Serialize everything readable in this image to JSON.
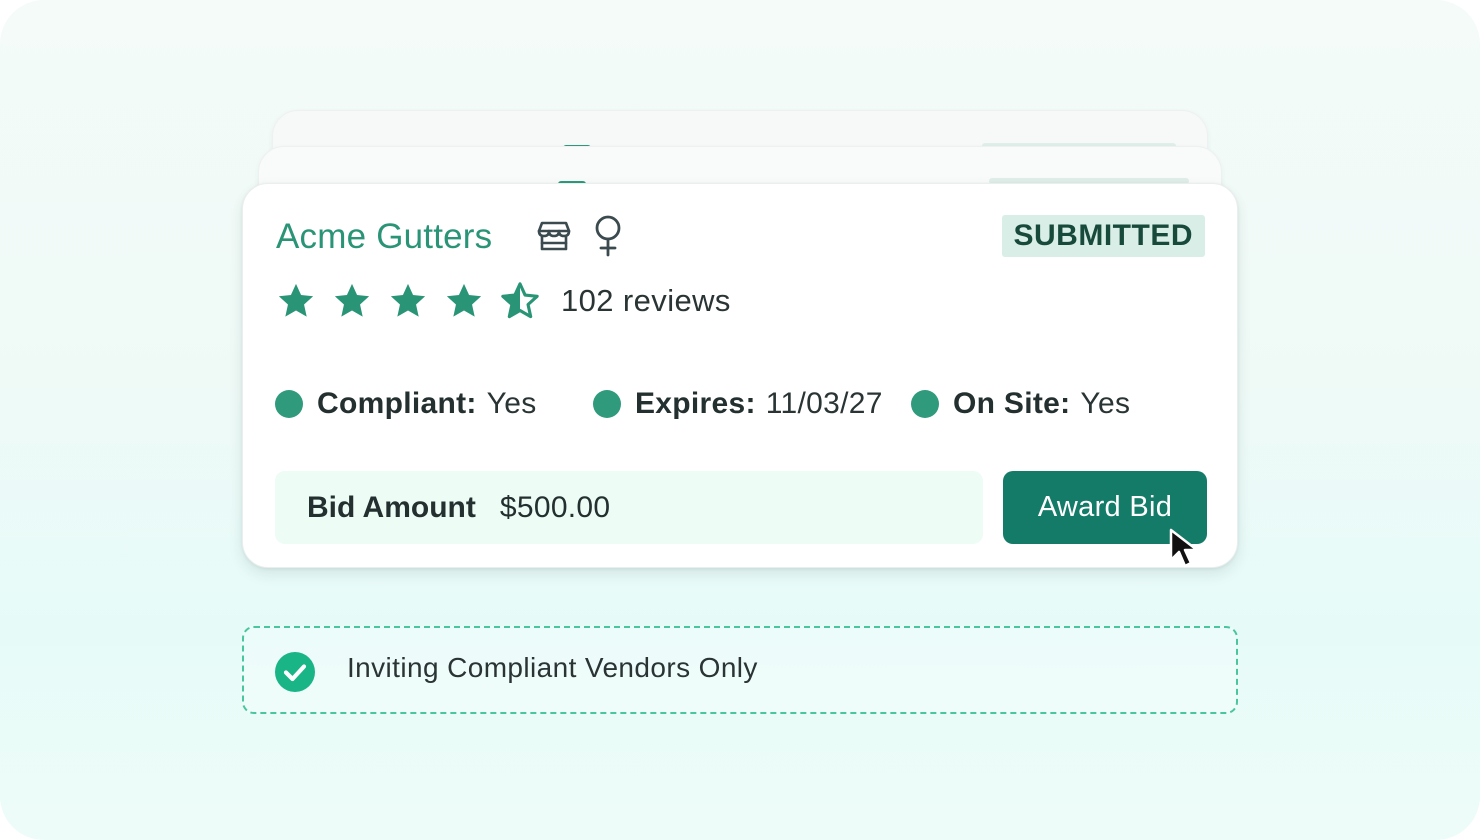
{
  "vendor": {
    "name": "Acme Gutters",
    "icons": [
      "store-icon",
      "female-icon"
    ],
    "status": "SUBMITTED",
    "rating": 4.5,
    "reviews_text": "102 reviews"
  },
  "meta": [
    {
      "label": "Compliant:",
      "value": "Yes"
    },
    {
      "label": "Expires:",
      "value": "11/03/27"
    },
    {
      "label": "On Site:",
      "value": "Yes"
    }
  ],
  "bid": {
    "label": "Bid Amount",
    "value": "$500.00",
    "button_label": "Award Bid"
  },
  "notice": {
    "text": "Inviting Compliant Vendors Only"
  },
  "colors": {
    "brand": "#2a9477",
    "button": "#137b67",
    "badge_bg": "#d8eee6",
    "badge_text": "#174a3b",
    "dot": "#2f9a7c",
    "notice_border": "#49c69c",
    "check": "#19b586"
  }
}
